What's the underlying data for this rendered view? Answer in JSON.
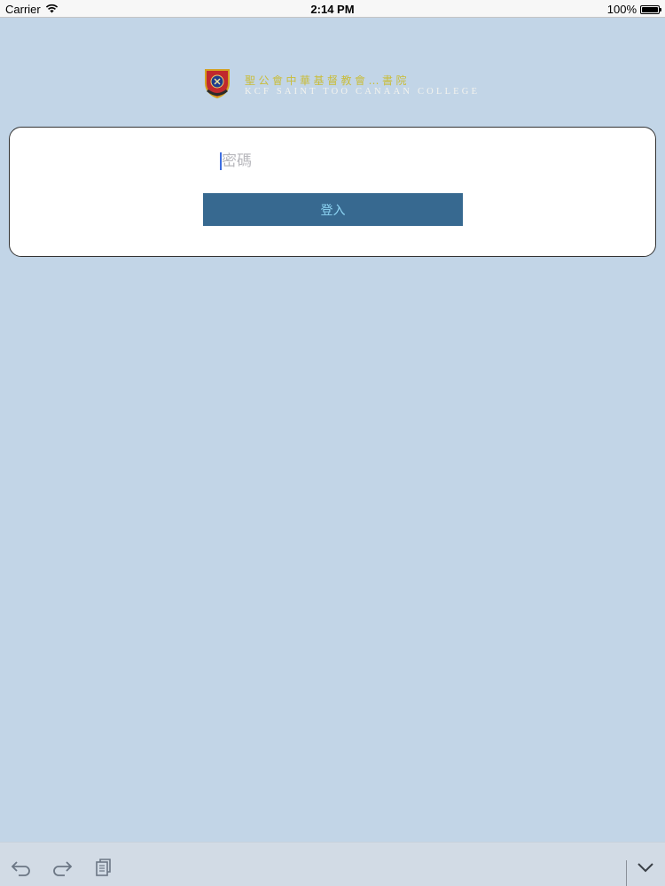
{
  "status_bar": {
    "carrier": "Carrier",
    "time": "2:14 PM",
    "battery": "100%",
    "battery_level": 1.0,
    "wifi_icon": "wifi-icon",
    "battery_icon": "battery-icon"
  },
  "logo": {
    "crest_icon": "school-crest-icon",
    "name_zh": "聖公會中華基督教會…書院",
    "name_en": "KCF SAINT TOO CANAAN COLLEGE"
  },
  "login": {
    "password_placeholder": "密碼",
    "password_value": "",
    "submit_label": "登入"
  },
  "toolbar": {
    "undo_icon": "undo-icon",
    "redo_icon": "redo-icon",
    "paste_icon": "paste-icon",
    "dismiss_icon": "chevron-down-icon"
  },
  "colors": {
    "background": "#c2d5e7",
    "button": "#376990",
    "button_text": "#8ed6f5",
    "school_name_zh": "#c9bd3a"
  }
}
